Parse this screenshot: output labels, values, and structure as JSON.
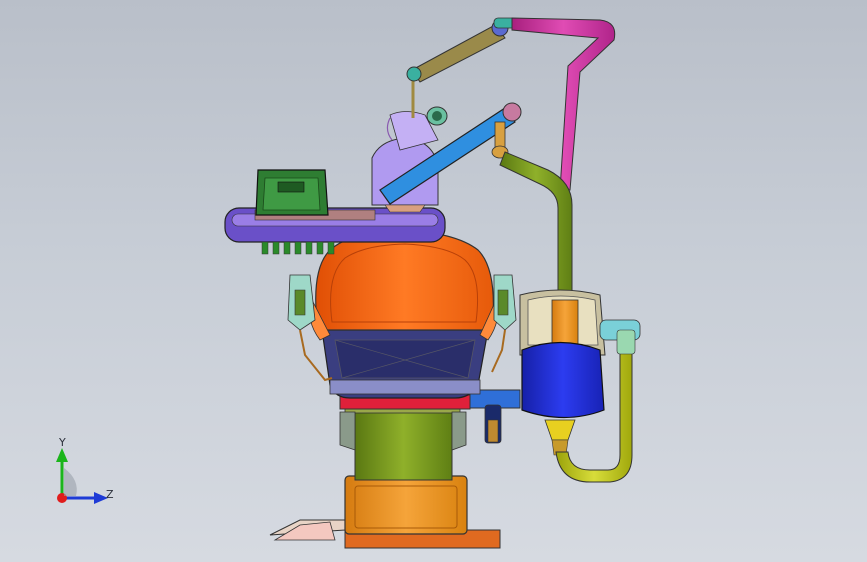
{
  "triad": {
    "y_label": "Y",
    "z_label": "Z",
    "colors": {
      "y": "#1bb51b",
      "z": "#1e3bd6",
      "x": "#e01c1c"
    }
  },
  "colors": {
    "background_top": "#b9bfc9",
    "seat_orange": "#ff6a14",
    "base_column_green": "#7a9a1e",
    "base_orange": "#f0951e",
    "tray_green": "#2e7d32",
    "arm_blue": "#2f8fe0",
    "lamp_purple": "#a88ee6",
    "magenta_arm": "#d43fa8",
    "delivery_blue": "#1f2fe0",
    "tan_arm": "#9a8a4a"
  }
}
